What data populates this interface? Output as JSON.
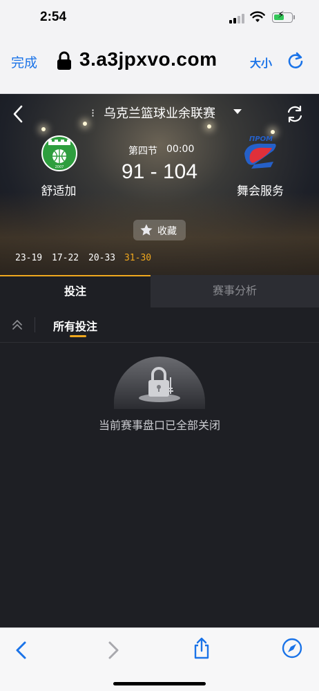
{
  "status_bar": {
    "time": "2:54",
    "icons": [
      "signal-icon",
      "wifi-icon",
      "battery-charging-icon"
    ]
  },
  "browser": {
    "done_label": "完成",
    "url": "3.a3jpxvo.com",
    "text_size_label": "大小",
    "icons": [
      "lock-icon",
      "reload-icon",
      "back-icon",
      "forward-icon",
      "share-icon",
      "compass-icon"
    ]
  },
  "match": {
    "league": "乌克兰篮球业余联赛",
    "period": "第四节",
    "clock": "00:00",
    "score": "91 - 104",
    "home_team": "舒适加",
    "away_team": "舞会服务",
    "favorite_label": "收藏",
    "quarters": [
      {
        "score": "23-19",
        "current": false
      },
      {
        "score": "17-22",
        "current": false
      },
      {
        "score": "20-33",
        "current": false
      },
      {
        "score": "31-30",
        "current": true
      }
    ],
    "home_logo_text": "KOMФOPT",
    "home_logo_year": "2007",
    "away_logo_text": "ПРОМ"
  },
  "tabs": [
    {
      "label": "投注",
      "active": true
    },
    {
      "label": "赛事分析",
      "active": false
    }
  ],
  "subtab": {
    "label": "所有投注"
  },
  "empty_state": {
    "message": "当前赛事盘口已全部关闭"
  },
  "colors": {
    "accent": "#f0a81e",
    "link_blue": "#1a73e8",
    "page_bg": "#1e1f24",
    "home_logo_green": "#2e9e3e",
    "away_logo_red": "#e0303a",
    "away_logo_blue": "#2560c8"
  }
}
